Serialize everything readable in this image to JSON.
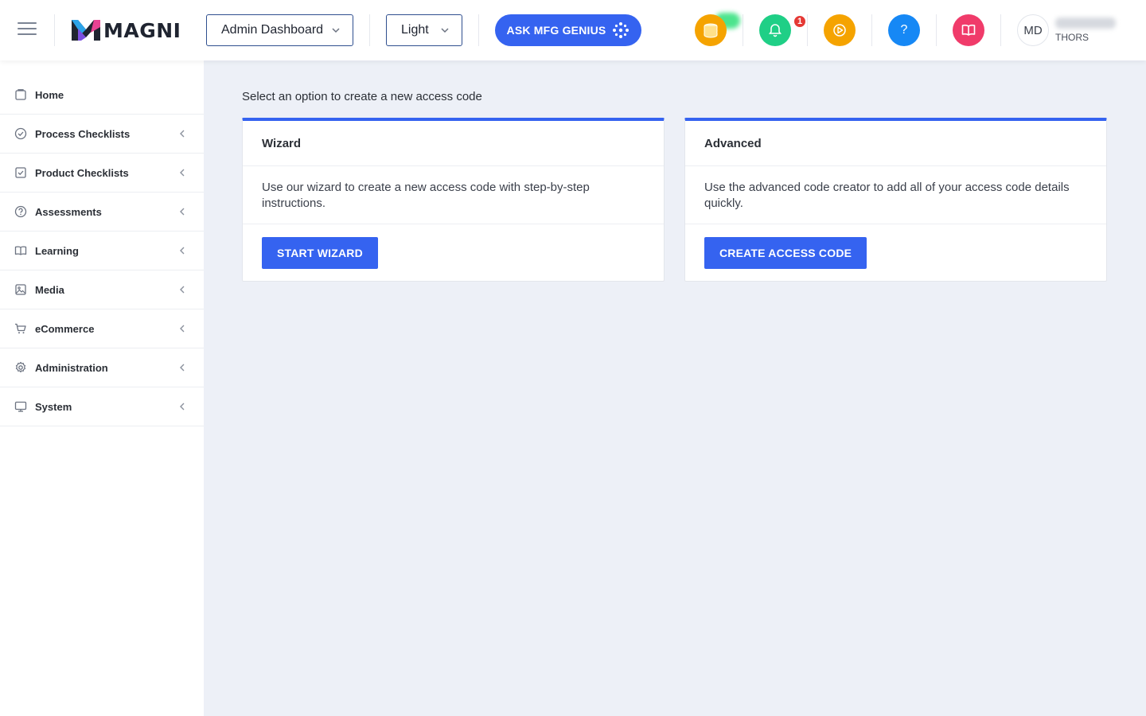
{
  "header": {
    "logo_text": "MAGNI",
    "dashboard_select": "Admin Dashboard",
    "theme_select": "Light",
    "ask_button": "ASK MFG GENIUS",
    "notification_count": "1",
    "avatar_initials": "MD",
    "user_org": "THORS",
    "colors": {
      "coins": "#f5a300",
      "notifications": "#1fcf86",
      "play": "#f5a300",
      "help": "#1688f5",
      "book": "#f03b6a",
      "accent": "#3563f0"
    },
    "icons": [
      "menu-icon",
      "coins-icon",
      "bell-icon",
      "play-icon",
      "help-icon",
      "book-icon",
      "sparkle-icon"
    ]
  },
  "sidebar": {
    "items": [
      {
        "label": "Home",
        "icon": "home-icon",
        "expandable": false
      },
      {
        "label": "Process Checklists",
        "icon": "check-circle-icon",
        "expandable": true
      },
      {
        "label": "Product Checklists",
        "icon": "check-square-icon",
        "expandable": true
      },
      {
        "label": "Assessments",
        "icon": "question-circle-icon",
        "expandable": true
      },
      {
        "label": "Learning",
        "icon": "book-open-icon",
        "expandable": true
      },
      {
        "label": "Media",
        "icon": "image-icon",
        "expandable": true
      },
      {
        "label": "eCommerce",
        "icon": "cart-icon",
        "expandable": true
      },
      {
        "label": "Administration",
        "icon": "gear-icon",
        "expandable": true
      },
      {
        "label": "System",
        "icon": "monitor-icon",
        "expandable": true
      }
    ]
  },
  "main": {
    "intro": "Select an option to create a new access code",
    "cards": [
      {
        "title": "Wizard",
        "description": "Use our wizard to create a new access code with step-by-step instructions.",
        "button": "START WIZARD"
      },
      {
        "title": "Advanced",
        "description": "Use the advanced code creator to add all of your access code details quickly.",
        "button": "CREATE ACCESS CODE"
      }
    ]
  }
}
